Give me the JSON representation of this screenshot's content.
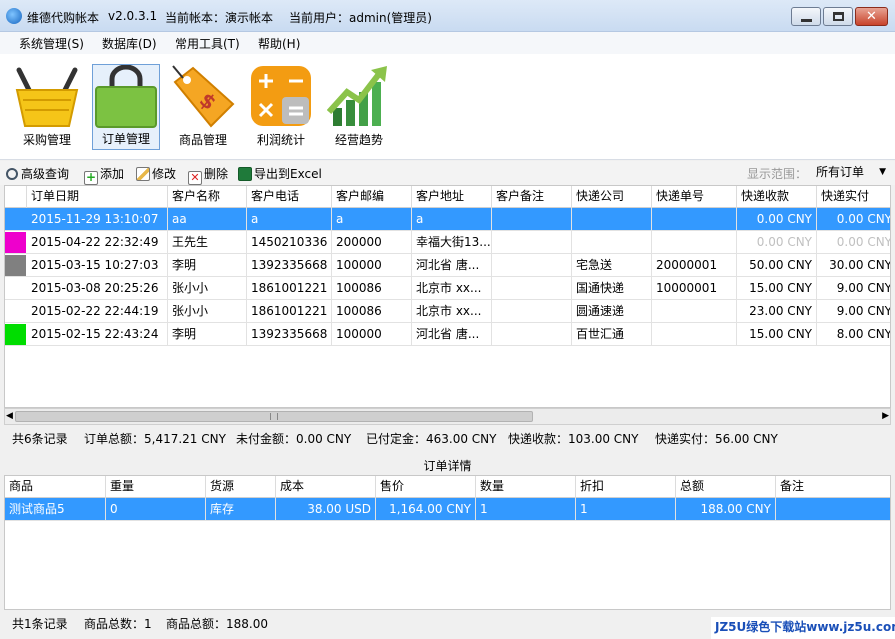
{
  "window": {
    "app_name": "维德代购帐本",
    "version": "v2.0.3.1",
    "current_book": "当前帐本：演示帐本",
    "current_user": "当前用户：admin(管理员)"
  },
  "menu": [
    "系统管理(S)",
    "数据库(D)",
    "常用工具(T)",
    "帮助(H)"
  ],
  "ribbon": [
    {
      "label": "采购管理",
      "icon": "basket-icon"
    },
    {
      "label": "订单管理",
      "icon": "shopping-bag-icon",
      "active": true
    },
    {
      "label": "商品管理",
      "icon": "price-tag-icon"
    },
    {
      "label": "利润统计",
      "icon": "calculator-icon"
    },
    {
      "label": "经营趋势",
      "icon": "trend-chart-icon"
    }
  ],
  "toolbar": {
    "search": "高级查询",
    "add": "添加",
    "edit": "修改",
    "delete": "删除",
    "export": "导出到Excel",
    "range_label": "显示范围：",
    "range_value": "所有订单"
  },
  "orders": {
    "columns": [
      "订单日期",
      "客户名称",
      "客户电话",
      "客户邮编",
      "客户地址",
      "客户备注",
      "快递公司",
      "快递单号",
      "快递收款",
      "快递实付"
    ],
    "rows": [
      {
        "mark": "",
        "cells": [
          "2015-11-29 13:10:07",
          "aa",
          "a",
          "a",
          "a",
          "",
          "",
          "",
          "0.00 CNY",
          "0.00 CNY"
        ],
        "selected": true
      },
      {
        "mark": "#ee00cc",
        "cells": [
          "2015-04-22 22:32:49",
          "王先生",
          "1450210336",
          "200000",
          "幸福大街13...",
          "",
          "",
          "",
          "0.00 CNY",
          "0.00 CNY"
        ],
        "muted": true
      },
      {
        "mark": "#808080",
        "cells": [
          "2015-03-15 10:27:03",
          "李明",
          "1392335668",
          "100000",
          "河北省 唐...",
          "",
          "宅急送",
          "20000001",
          "50.00 CNY",
          "30.00 CNY"
        ]
      },
      {
        "mark": "",
        "cells": [
          "2015-03-08 20:25:26",
          "张小小",
          "1861001221",
          "100086",
          "北京市 xx...",
          "",
          "国通快递",
          "10000001",
          "15.00 CNY",
          "9.00 CNY"
        ]
      },
      {
        "mark": "",
        "cells": [
          "2015-02-22 22:44:19",
          "张小小",
          "1861001221",
          "100086",
          "北京市 xx...",
          "",
          "圆通速递",
          "",
          "23.00 CNY",
          "9.00 CNY"
        ]
      },
      {
        "mark": "#00dd00",
        "cells": [
          "2015-02-15 22:43:24",
          "李明",
          "1392335668",
          "100000",
          "河北省 唐...",
          "",
          "百世汇通",
          "",
          "15.00 CNY",
          "8.00 CNY"
        ]
      }
    ]
  },
  "summary": {
    "count": "共6条记录",
    "total": "订单总额：5,417.21 CNY",
    "unpaid": "未付金额：0.00 CNY",
    "deposit": "已付定金：463.00 CNY",
    "shipping_in": "快递收款：103.00 CNY",
    "shipping_out": "快递实付：56.00 CNY"
  },
  "detail": {
    "title": "订单详情",
    "columns": [
      "商品",
      "重量",
      "货源",
      "成本",
      "售价",
      "数量",
      "折扣",
      "总额",
      "备注"
    ],
    "rows": [
      {
        "cells": [
          "测试商品5",
          "0",
          "库存",
          "38.00 USD",
          "1,164.00 CNY",
          "1",
          "1",
          "188.00 CNY",
          ""
        ],
        "selected": true
      }
    ]
  },
  "footer": {
    "count": "共1条记录",
    "qty": "商品总数：1",
    "amount": "商品总额：188.00"
  },
  "watermark": "JZ5U绿色下载站www.jz5u.com"
}
